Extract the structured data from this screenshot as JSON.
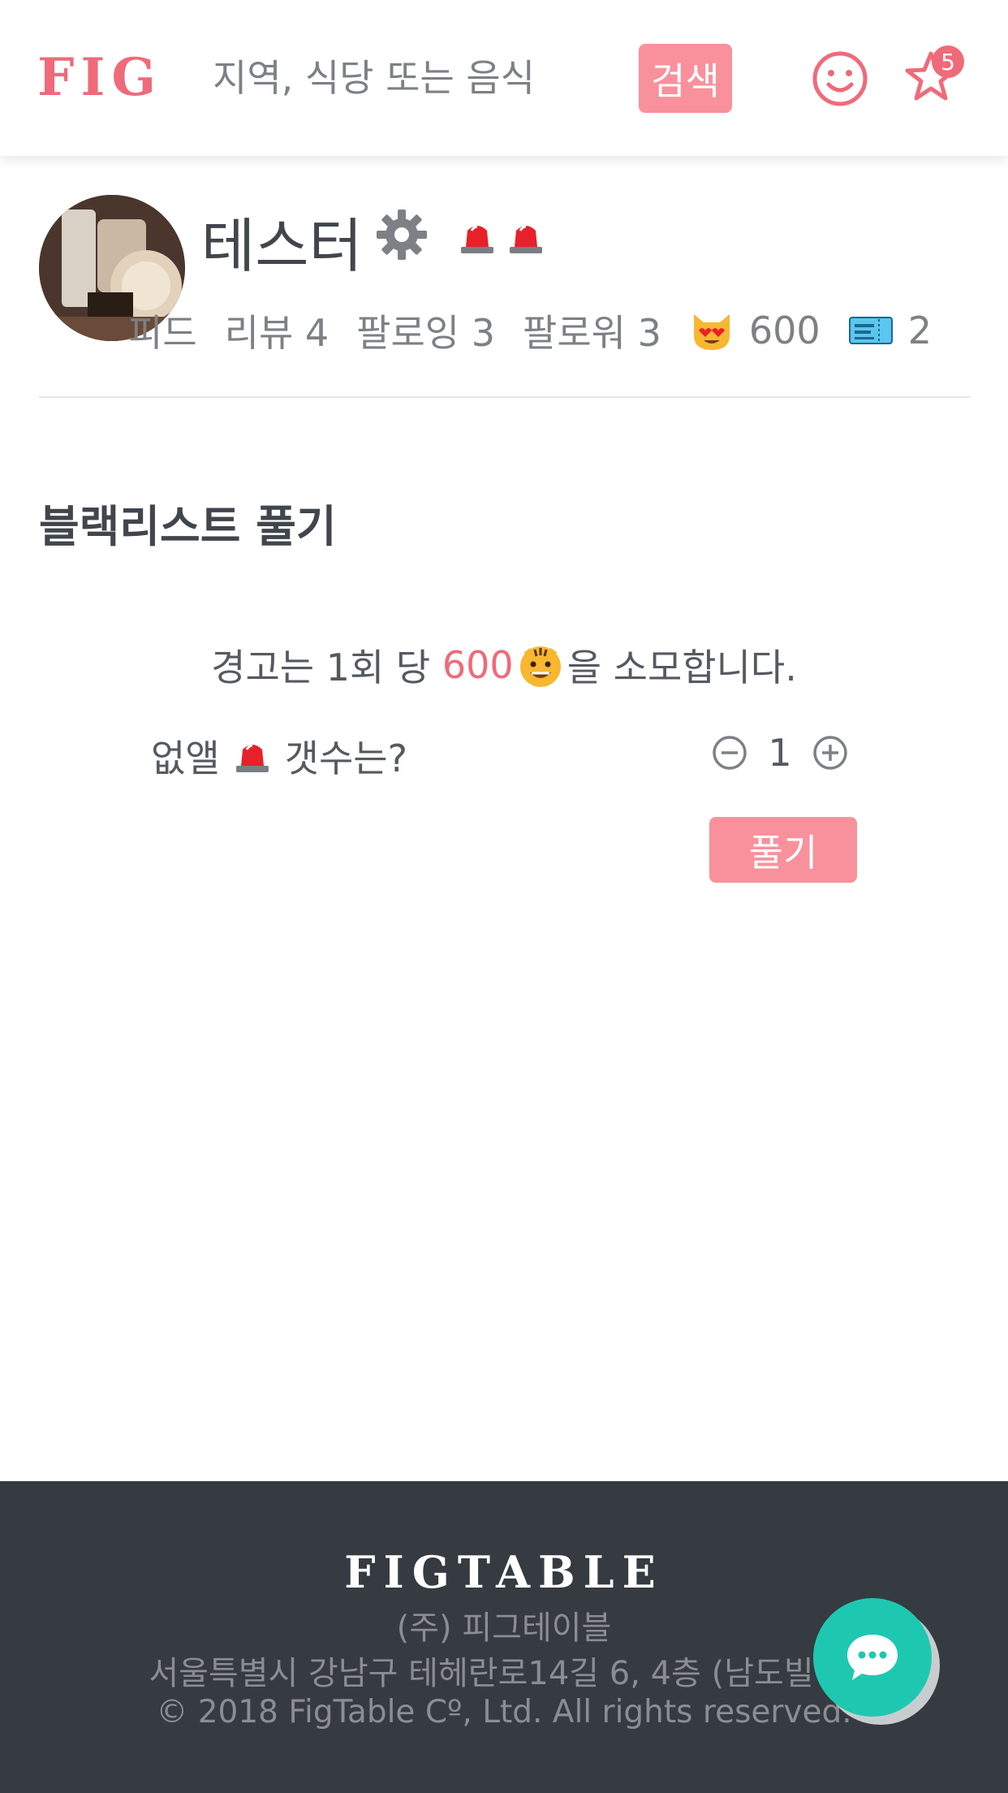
{
  "header": {
    "logo": "FIG",
    "search_placeholder": "지역, 식당 또는 음식",
    "search_button": "검색",
    "favorites_badge": "5"
  },
  "profile": {
    "name": "테스터",
    "warning_count": 2,
    "stats": {
      "feed": "피드",
      "reviews": "리뷰 4",
      "following": "팔로잉 3",
      "followers": "팔로워 3",
      "points": "600",
      "tickets": "2"
    }
  },
  "main": {
    "title": "블랙리스트 풀기",
    "notice_prefix": "경고는 1회 당 ",
    "notice_cost": "600",
    "notice_suffix": "을 소모합니다.",
    "remove_label_before": "없앨",
    "remove_label_after": "갯수는?",
    "quantity": "1",
    "release_button": "풀기"
  },
  "footer": {
    "logo": "FIGTABLE",
    "company": "(주) 피그테이블",
    "address": "서울특별시 강남구 테헤란로14길 6, 4층 (남도빌",
    "copyright": "© 2018 FigTable Cº, Ltd. All rights reserved."
  },
  "colors": {
    "brand": "#f06a7a",
    "button": "#f8919c",
    "footer_bg": "#363a41",
    "chat": "#1ec8b0"
  },
  "icons": [
    "smile-icon",
    "star-icon",
    "gear-icon",
    "siren-icon",
    "heart-eyes-cat-icon",
    "ticket-icon",
    "tiger-icon",
    "minus-circle-icon",
    "plus-circle-icon",
    "chat-icon"
  ]
}
